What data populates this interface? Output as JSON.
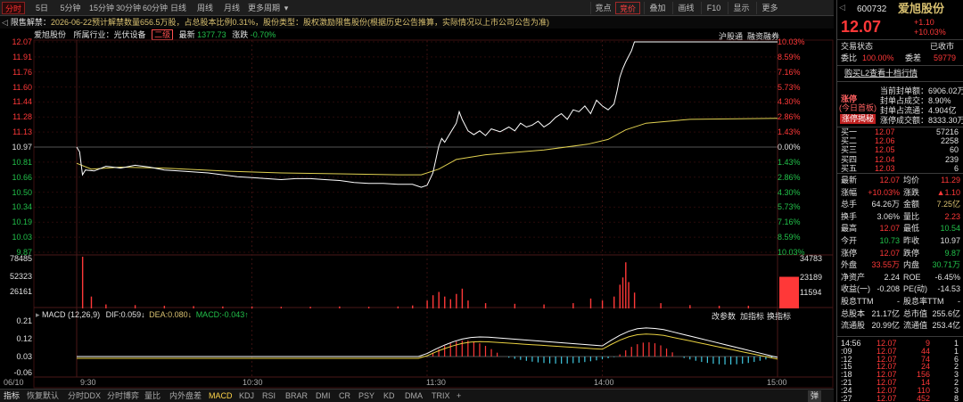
{
  "toolbar": {
    "tabs": [
      "分时",
      "5日",
      "5分钟",
      "15分钟",
      "30分钟",
      "60分钟",
      "日线",
      "周线",
      "月线",
      "更多周期"
    ],
    "more_arrow": "▾",
    "active_tab": "分时",
    "right_tabs": [
      "竞点",
      "竞价",
      "叠加",
      "画线",
      "F10",
      "显示",
      "更多"
    ],
    "active_right_tab": "竞价"
  },
  "notice": {
    "arrow": "◁",
    "label": "限售解禁：",
    "text": "2026-06-22预计解禁数量656.5万股，占总股本比例0.31%，股份类型：股权激励限售股份(根据历史公告推算，实际情况以上市公司公告为准)"
  },
  "info": {
    "name": "爱旭股份",
    "industry": "所属行业：光伏设备",
    "level": "二级",
    "latest_label": "最新",
    "latest_value": "1377.73",
    "change_label": "涨跌",
    "change_value": "-0.70%",
    "link1": "沪股通",
    "link2": "融资融券"
  },
  "price_axis": {
    "left": [
      "12.07",
      "11.91",
      "11.76",
      "11.60",
      "11.44",
      "11.28",
      "11.13",
      "10.97",
      "10.81",
      "10.66",
      "10.50",
      "10.34",
      "10.19",
      "10.03",
      "9.87"
    ],
    "right": [
      "10.03%",
      "8.59%",
      "7.16%",
      "5.73%",
      "4.30%",
      "2.86%",
      "1.43%",
      "0.00%",
      "1.43%",
      "2.86%",
      "4.30%",
      "5.73%",
      "7.16%",
      "8.59%",
      "10.03%"
    ]
  },
  "volume_axis": {
    "left": [
      "78485",
      "52323",
      "26161"
    ],
    "right": [
      "34783",
      "23189",
      "11594"
    ]
  },
  "macd": {
    "label": "MACD (12,26,9)",
    "dif": "DIF:0.059↓",
    "dea": "DEA:0.080↓",
    "macd": "MACD:-0.043↑",
    "axis": [
      "0.21",
      "0.12",
      "0.03",
      "-0.06"
    ],
    "links": [
      "改参数",
      "加指标",
      "换指标"
    ]
  },
  "time_axis": [
    "06/10",
    "9:30",
    "10:30",
    "11:30",
    "14:00",
    "15:00"
  ],
  "indicator_tabs": [
    "指标",
    "恢复默认",
    "分时DDX",
    "分时博弈",
    "量比",
    "内外盘差",
    "MACD",
    "KDJ",
    "RSI",
    "BRAR",
    "DMI",
    "CR",
    "PSY",
    "KD",
    "DMA",
    "TRIX",
    "+"
  ],
  "active_indicator": "MACD",
  "collapse_label": "弹",
  "collapse_arrow": "◁",
  "quote": {
    "code": "600732",
    "name": "爱旭股份",
    "price": "12.07",
    "change": "+1.10",
    "change_pct": "+10.03%",
    "status_label": "交易状态",
    "status_value": "已收市",
    "commission_label": "委比",
    "commission_value": "100.00%",
    "diff_label": "委差",
    "diff_value": "59779",
    "l2_link": "购买L2查看十档行情",
    "limit_tag": "涨停",
    "limit_sub": "(今日首板)",
    "limit_btn": "涨停揭秘",
    "seal_stats": [
      {
        "label": "当前封单额：",
        "value": "6906.02万"
      },
      {
        "label": "封单占成交：",
        "value": "8.90%"
      },
      {
        "label": "封单占流通：",
        "value": "4.904亿"
      },
      {
        "label": "涨停成交额：",
        "value": "8333.30万"
      }
    ],
    "order_book": {
      "sells": [
        {
          "label": "卖五",
          "price": "",
          "vol": ""
        },
        {
          "label": "卖四",
          "price": "",
          "vol": ""
        },
        {
          "label": "卖三",
          "price": "",
          "vol": ""
        },
        {
          "label": "卖二",
          "price": "",
          "vol": ""
        },
        {
          "label": "卖一",
          "price": "",
          "vol": ""
        }
      ],
      "buys": [
        {
          "label": "买一",
          "price": "12.07",
          "vol": "57216"
        },
        {
          "label": "买二",
          "price": "12.06",
          "vol": "2258"
        },
        {
          "label": "买三",
          "price": "12.05",
          "vol": "60"
        },
        {
          "label": "买四",
          "price": "12.04",
          "vol": "239"
        },
        {
          "label": "买五",
          "price": "12.03",
          "vol": "6"
        }
      ]
    },
    "stats": [
      {
        "l1": "最新",
        "v1": "12.07",
        "c1": "r",
        "l2": "均价",
        "v2": "11.29",
        "c2": "r"
      },
      {
        "l1": "涨幅",
        "v1": "+10.03%",
        "c1": "r",
        "l2": "涨跌",
        "v2": "▲1.10",
        "c2": "r"
      },
      {
        "l1": "总手",
        "v1": "64.26万",
        "c1": "w",
        "l2": "金额",
        "v2": "7.25亿",
        "c2": "y"
      },
      {
        "l1": "换手",
        "v1": "3.06%",
        "c1": "w",
        "l2": "量比",
        "v2": "2.23",
        "c2": "r"
      },
      {
        "l1": "最高",
        "v1": "12.07",
        "c1": "r",
        "l2": "最低",
        "v2": "10.54",
        "c2": "g"
      },
      {
        "l1": "今开",
        "v1": "10.73",
        "c1": "g",
        "l2": "昨收",
        "v2": "10.97",
        "c2": "w"
      },
      {
        "l1": "涨停",
        "v1": "12.07",
        "c1": "r",
        "l2": "跌停",
        "v2": "9.87",
        "c2": "g"
      },
      {
        "l1": "外盘",
        "v1": "33.55万",
        "c1": "r",
        "l2": "内盘",
        "v2": "30.71万",
        "c2": "g"
      },
      {
        "l1": "净资产",
        "v1": "2.24",
        "c1": "w",
        "l2": "ROE",
        "v2": "-6.45%",
        "c2": "w"
      },
      {
        "l1": "收益(一)",
        "v1": "-0.208",
        "c1": "w",
        "l2": "PE(动)",
        "v2": "-14.53",
        "c2": "w"
      },
      {
        "l1": "股息TTM",
        "v1": "-",
        "c1": "w",
        "l2": "股息率TTM",
        "v2": "-",
        "c2": "w"
      },
      {
        "l1": "总股本",
        "v1": "21.17亿",
        "c1": "w",
        "l2": "总市值",
        "v2": "255.6亿",
        "c2": "w"
      },
      {
        "l1": "流通股",
        "v1": "20.99亿",
        "c1": "w",
        "l2": "流通值",
        "v2": "253.4亿",
        "c2": "w"
      }
    ],
    "trades": [
      {
        "t": "14:56",
        "p": "12.07",
        "v": "9",
        "d": "1"
      },
      {
        "t": ":09",
        "p": "12.07",
        "v": "44",
        "d": "1"
      },
      {
        "t": ":12",
        "p": "12.07",
        "v": "74",
        "d": "6"
      },
      {
        "t": ":15",
        "p": "12.07",
        "v": "24",
        "d": "2"
      },
      {
        "t": ":18",
        "p": "12.07",
        "v": "156",
        "d": "3"
      },
      {
        "t": ":21",
        "p": "12.07",
        "v": "14",
        "d": "2"
      },
      {
        "t": ":24",
        "p": "12.07",
        "v": "110",
        "d": "3"
      },
      {
        "t": ":27",
        "p": "12.07",
        "v": "452",
        "d": "8"
      }
    ]
  },
  "colors": {
    "up": "#ff3838",
    "down": "#22c04a",
    "price_line": "#ffffff",
    "avg_line": "#e0d050",
    "dif_line": "#ffffff",
    "dea_line": "#e8d040",
    "macd_neg": "#40c8e0"
  },
  "chart_data": {
    "type": "line",
    "prev_close": 10.97,
    "ylim": [
      9.87,
      12.07
    ],
    "time_span": [
      "9:30",
      "15:00"
    ],
    "series": [
      {
        "name": "价格",
        "points": [
          [
            0,
            10.97
          ],
          [
            1,
            10.92
          ],
          [
            2,
            10.68
          ],
          [
            3,
            10.73
          ],
          [
            6,
            10.72
          ],
          [
            10,
            10.77
          ],
          [
            15,
            10.75
          ],
          [
            20,
            10.78
          ],
          [
            25,
            10.76
          ],
          [
            30,
            10.73
          ],
          [
            35,
            10.72
          ],
          [
            40,
            10.71
          ],
          [
            45,
            10.7
          ],
          [
            50,
            10.68
          ],
          [
            55,
            10.66
          ],
          [
            60,
            10.65
          ],
          [
            65,
            10.64
          ],
          [
            70,
            10.63
          ],
          [
            75,
            10.64
          ],
          [
            80,
            10.64
          ],
          [
            85,
            10.63
          ],
          [
            90,
            10.62
          ],
          [
            95,
            10.6
          ],
          [
            100,
            10.59
          ],
          [
            105,
            10.59
          ],
          [
            110,
            10.58
          ],
          [
            115,
            10.58
          ],
          [
            118,
            10.55
          ],
          [
            120,
            10.57
          ],
          [
            122,
            10.7
          ],
          [
            124,
            10.98
          ],
          [
            125,
            11.06
          ],
          [
            126,
            11.02
          ],
          [
            128,
            11.12
          ],
          [
            130,
            11.22
          ],
          [
            131,
            11.34
          ],
          [
            132,
            11.26
          ],
          [
            134,
            11.14
          ],
          [
            136,
            11.1
          ],
          [
            138,
            11.14
          ],
          [
            140,
            11.09
          ],
          [
            142,
            11.16
          ],
          [
            145,
            11.13
          ],
          [
            148,
            11.18
          ],
          [
            150,
            11.14
          ],
          [
            152,
            11.22
          ],
          [
            154,
            11.18
          ],
          [
            156,
            11.2
          ],
          [
            158,
            11.24
          ],
          [
            160,
            11.18
          ],
          [
            162,
            11.22
          ],
          [
            164,
            11.28
          ],
          [
            166,
            11.32
          ],
          [
            168,
            11.26
          ],
          [
            170,
            11.36
          ],
          [
            172,
            11.34
          ],
          [
            174,
            11.4
          ],
          [
            176,
            11.32
          ],
          [
            178,
            11.46
          ],
          [
            180,
            11.4
          ],
          [
            182,
            11.36
          ],
          [
            184,
            11.42
          ],
          [
            185,
            11.55
          ],
          [
            186,
            11.7
          ],
          [
            187,
            11.79
          ],
          [
            188,
            11.86
          ],
          [
            190,
            11.98
          ],
          [
            191,
            12.07
          ],
          [
            240,
            12.07
          ]
        ]
      },
      {
        "name": "均价",
        "points": [
          [
            0,
            10.8
          ],
          [
            5,
            10.74
          ],
          [
            15,
            10.76
          ],
          [
            30,
            10.75
          ],
          [
            50,
            10.72
          ],
          [
            70,
            10.7
          ],
          [
            90,
            10.69
          ],
          [
            110,
            10.68
          ],
          [
            118,
            10.68
          ],
          [
            124,
            10.74
          ],
          [
            130,
            10.84
          ],
          [
            140,
            10.89
          ],
          [
            160,
            10.94
          ],
          [
            175,
            11.0
          ],
          [
            182,
            11.05
          ],
          [
            188,
            11.15
          ],
          [
            195,
            11.22
          ],
          [
            210,
            11.26
          ],
          [
            240,
            11.27
          ]
        ]
      }
    ],
    "volume": {
      "bars": [
        [
          2,
          78485
        ],
        [
          5,
          18000
        ],
        [
          10,
          6000
        ],
        [
          20,
          5000
        ],
        [
          30,
          4000
        ],
        [
          40,
          3500
        ],
        [
          50,
          3000
        ],
        [
          60,
          3000
        ],
        [
          70,
          2500
        ],
        [
          80,
          2500
        ],
        [
          90,
          3000
        ],
        [
          100,
          2500
        ],
        [
          110,
          3000
        ],
        [
          115,
          4500
        ],
        [
          120,
          12000
        ],
        [
          122,
          20000
        ],
        [
          124,
          25000
        ],
        [
          126,
          18000
        ],
        [
          128,
          14000
        ],
        [
          130,
          22000
        ],
        [
          132,
          30000
        ],
        [
          134,
          12000
        ],
        [
          140,
          8000
        ],
        [
          150,
          7000
        ],
        [
          160,
          6000
        ],
        [
          170,
          8000
        ],
        [
          176,
          15000
        ],
        [
          180,
          12000
        ],
        [
          184,
          18000
        ],
        [
          186,
          36000
        ],
        [
          187,
          47000
        ],
        [
          188,
          70000
        ],
        [
          189,
          40000
        ],
        [
          191,
          24000
        ],
        [
          200,
          8000
        ],
        [
          210,
          5000
        ],
        [
          220,
          4000
        ],
        [
          230,
          4000
        ],
        [
          240,
          48000
        ]
      ]
    },
    "macd_indicator": {
      "dif": 0.059,
      "dea": 0.08,
      "macd": -0.043
    }
  }
}
